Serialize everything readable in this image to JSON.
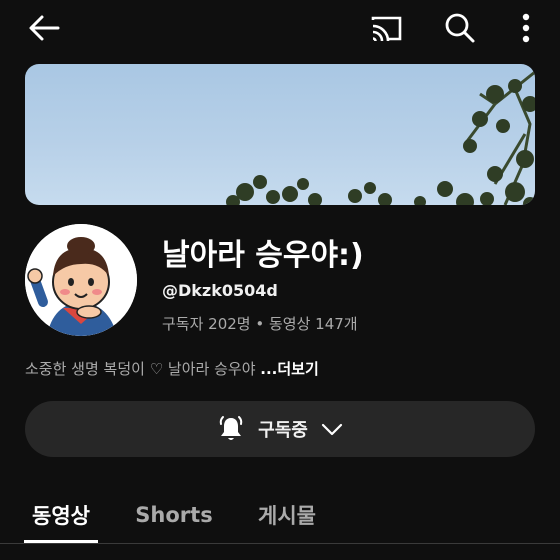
{
  "topbar": {
    "back_icon": "arrow-left-icon",
    "cast_icon": "cast-icon",
    "search_icon": "search-icon",
    "more_icon": "more-vert-icon"
  },
  "channel": {
    "name": "날아라 승우야:)",
    "handle": "@Dkzk0504d",
    "stats": "구독자 202명 • 동영상 147개",
    "description": "소중한 생명 복덩이 ♡ 날아라 승우야 ",
    "description_more": "...더보기"
  },
  "subscribe": {
    "label": "구독중",
    "bell_icon": "bell-ringing-icon",
    "chevron_icon": "chevron-down-icon"
  },
  "tabs": [
    {
      "label": "동영상",
      "active": true
    },
    {
      "label": "Shorts",
      "active": false
    },
    {
      "label": "게시물",
      "active": false
    }
  ],
  "colors": {
    "background": "#0f0f0f",
    "button_bg": "#272727",
    "secondary_text": "#aaaaaa"
  }
}
